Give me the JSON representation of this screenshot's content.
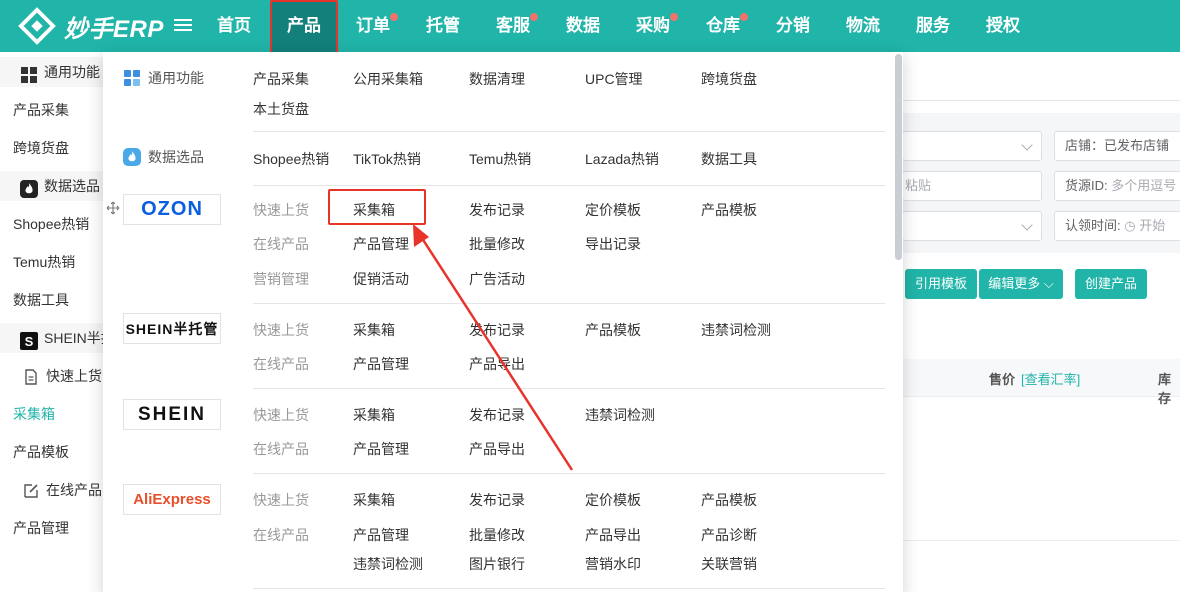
{
  "app": {
    "logo_text": "妙手ERP"
  },
  "nav": {
    "items": [
      {
        "label": "首页",
        "dot": false
      },
      {
        "label": "产品",
        "dot": false,
        "active": true
      },
      {
        "label": "订单",
        "dot": true
      },
      {
        "label": "托管",
        "dot": false
      },
      {
        "label": "客服",
        "dot": true
      },
      {
        "label": "数据",
        "dot": false
      },
      {
        "label": "采购",
        "dot": true
      },
      {
        "label": "仓库",
        "dot": true
      },
      {
        "label": "分销",
        "dot": false
      },
      {
        "label": "物流",
        "dot": false
      },
      {
        "label": "服务",
        "dot": false
      },
      {
        "label": "授权",
        "dot": false
      }
    ]
  },
  "sidebar": {
    "items": [
      {
        "label": "通用功能"
      },
      {
        "label": "产品采集"
      },
      {
        "label": "跨境货盘"
      },
      {
        "label": "数据选品"
      },
      {
        "label": "Shopee热销"
      },
      {
        "label": "Temu热销"
      },
      {
        "label": "数据工具"
      },
      {
        "label": "SHEIN半托管"
      },
      {
        "label": "快速上货"
      },
      {
        "label": "采集箱"
      },
      {
        "label": "产品模板"
      },
      {
        "label": "在线产品"
      },
      {
        "label": "产品管理"
      }
    ]
  },
  "background": {
    "store_filter": "店铺：已发布店铺",
    "paste_placeholder": "粘贴",
    "source_id_label": "货源ID:",
    "source_id_placeholder": "多个用逗号",
    "claim_time_label": "认领时间:",
    "claim_time_placeholder": "开始",
    "btn_ref_template": "引用模板",
    "btn_edit_more": "编辑更多",
    "btn_create_product": "创建产品",
    "col_price": "售价",
    "col_price_link": "[查看汇率]",
    "col_stock": "库存"
  },
  "menu": {
    "general": {
      "label": "通用功能",
      "links": [
        "产品采集",
        "公用采集箱",
        "数据清理",
        "UPC管理",
        "跨境货盘",
        "本土货盘"
      ]
    },
    "data_select": {
      "label": "数据选品",
      "links": [
        "Shopee热销",
        "TikTok热销",
        "Temu热销",
        "Lazada热销",
        "数据工具"
      ]
    },
    "ozon": {
      "brand": "OZON",
      "row1": [
        "快速上货",
        "采集箱",
        "发布记录",
        "定价模板",
        "产品模板"
      ],
      "row2": [
        "在线产品",
        "产品管理",
        "批量修改",
        "导出记录"
      ],
      "row3": [
        "营销管理",
        "促销活动",
        "广告活动"
      ]
    },
    "shein_semi": {
      "brand": "SHEIN半托管",
      "row1": [
        "快速上货",
        "采集箱",
        "发布记录",
        "产品模板",
        "违禁词检测"
      ],
      "row2": [
        "在线产品",
        "产品管理",
        "产品导出"
      ]
    },
    "shein": {
      "brand": "SHEIN",
      "row1": [
        "快速上货",
        "采集箱",
        "发布记录",
        "违禁词检测"
      ],
      "row2": [
        "在线产品",
        "产品管理",
        "产品导出"
      ]
    },
    "aliexpress": {
      "brand": "AliExpress",
      "row1": [
        "快速上货",
        "采集箱",
        "发布记录",
        "定价模板",
        "产品模板"
      ],
      "row2": [
        "在线产品",
        "产品管理",
        "批量修改",
        "产品导出",
        "产品诊断"
      ],
      "row3": [
        "违禁词检测",
        "图片银行",
        "营销水印",
        "关联营销"
      ]
    }
  },
  "colors": {
    "brand": "#21b4a9",
    "brand_dark": "#14807c",
    "annotation_red": "#e8332b"
  }
}
